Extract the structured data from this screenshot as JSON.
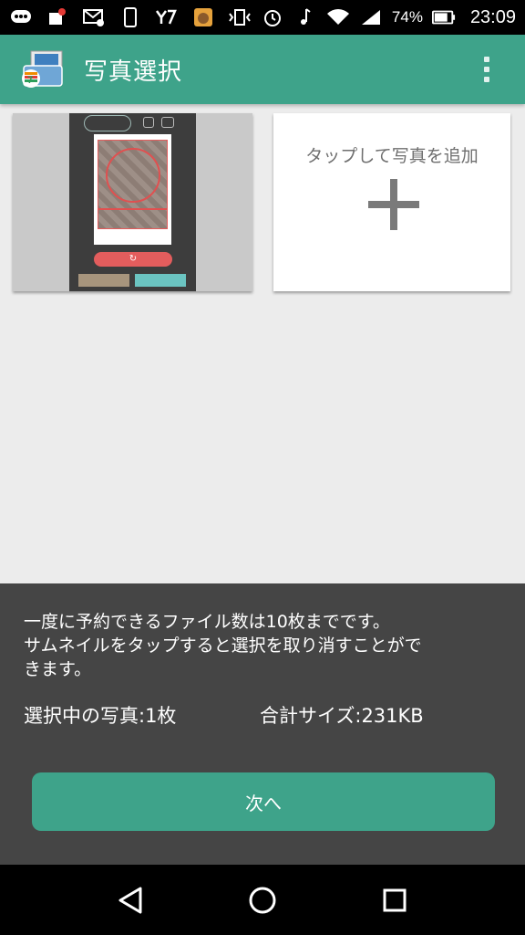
{
  "statusbar": {
    "battery": "74%",
    "time": "23:09"
  },
  "appbar": {
    "title": "写真選択"
  },
  "add_card": {
    "label": "タップして写真を追加"
  },
  "panel": {
    "info_line1": "一度に予約できるファイル数は10枚までです。",
    "info_line2": "サムネイルをタップすると選択を取り消すことがで",
    "info_line3": "きます。",
    "selected_count": "選択中の写真:1枚",
    "total_size": "合計サイズ:231KB",
    "next_button": "次へ"
  },
  "colors": {
    "accent": "#3ea38a",
    "panel": "#454545"
  }
}
